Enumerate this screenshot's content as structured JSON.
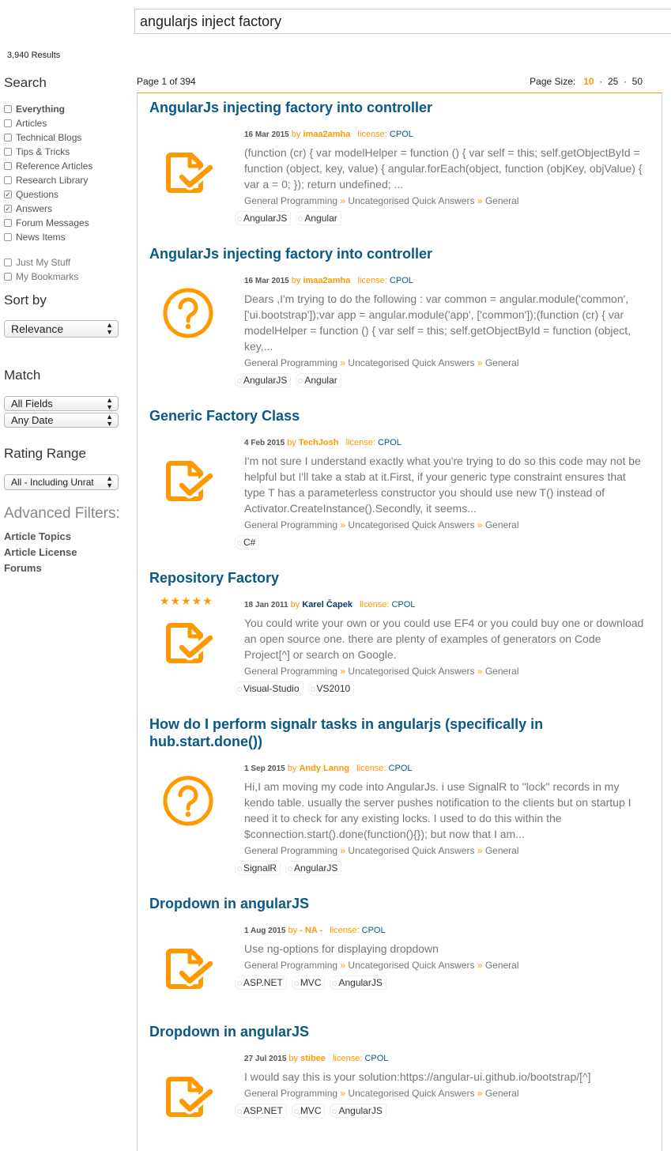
{
  "search": {
    "query": "angularjs inject factory"
  },
  "results_count": "3,940 Results",
  "sidebar": {
    "search_heading": "Search",
    "types": [
      {
        "label": "Everything",
        "checked": false
      },
      {
        "label": "Articles",
        "checked": false
      },
      {
        "label": "Technical Blogs",
        "checked": false
      },
      {
        "label": "Tips & Tricks",
        "checked": false
      },
      {
        "label": "Reference Articles",
        "checked": false
      },
      {
        "label": "Research Library",
        "checked": false
      },
      {
        "label": "Questions",
        "checked": true
      },
      {
        "label": "Answers",
        "checked": true
      },
      {
        "label": "Forum Messages",
        "checked": false
      },
      {
        "label": "News Items",
        "checked": false
      }
    ],
    "personal": [
      {
        "label": "Just My Stuff",
        "checked": false
      },
      {
        "label": "My Bookmarks",
        "checked": false
      }
    ],
    "sort_heading": "Sort by",
    "sort_value": "Relevance",
    "match_heading": "Match",
    "match_fields": "All Fields",
    "match_date": "Any Date",
    "rating_heading": "Rating Range",
    "rating_value": "All - Including Unrat",
    "advanced_heading": "Advanced Filters:",
    "advanced_links": [
      "Article Topics",
      "Article License",
      "Forums"
    ]
  },
  "pager": {
    "page_text": "Page 1 of 394",
    "size_label": "Page Size:",
    "sizes": [
      "10",
      "25",
      "50"
    ],
    "current_size": "10"
  },
  "results": [
    {
      "title": "AngularJs injecting factory into controller",
      "icon": "answer-document-check-icon",
      "date": "16 Mar 2015",
      "by": "by",
      "author": "imaa2amha",
      "license_label": "license:",
      "license": "CPOL",
      "desc": "(function (cr) { var modelHelper = function () { var self = this; self.getObjectById = function (object, key, value) { angular.forEach(object, function (objKey, objValue) { var a = 0; }); return undefined; ...",
      "cat": [
        "General Programming",
        "Uncategorised Quick Answers",
        "General"
      ],
      "tags": [
        "AngularJS",
        "Angular"
      ]
    },
    {
      "title": "AngularJs injecting factory into controller",
      "icon": "question-circle-icon",
      "date": "16 Mar 2015",
      "by": "by",
      "author": "imaa2amha",
      "license_label": "license:",
      "license": "CPOL",
      "desc": "Dears ,I'm trying to do the following : var common = angular.module('common', ['ui.bootstrap']);var app = angular.module('app', ['common']);(function (cr) { var modelHelper = function () { var self = this; self.getObjectById = function (object, key,...",
      "cat": [
        "General Programming",
        "Uncategorised Quick Answers",
        "General"
      ],
      "tags": [
        "AngularJS",
        "Angular"
      ]
    },
    {
      "title": "Generic Factory Class",
      "icon": "answer-document-check-icon",
      "date": "4 Feb 2015",
      "by": "by",
      "author": "TechJosh",
      "license_label": "license:",
      "license": "CPOL",
      "desc": "I'm not sure I understand exactly what you're trying to do so this code may not be helpful but I'll take a stab at it.First, if your generic type constraint ensures that type T has a parameterless constructor you should use new T() instead of Activator.CreateInstance().Secondly, it seems...",
      "cat": [
        "General Programming",
        "Uncategorised Quick Answers",
        "General"
      ],
      "tags": [
        "C#"
      ]
    },
    {
      "title": "Repository Factory",
      "icon": "answer-document-check-icon",
      "stars": "★★★★★",
      "date": "18 Jan 2011",
      "by": "by",
      "author": "Karel Čapek",
      "license_label": "license:",
      "license": "CPOL",
      "desc": "You could write your own or you could use EF4 or you could buy one or download an open source one. there are plenty of examples of generators on Code Project[^] or search on Google.",
      "cat": [
        "General Programming",
        "Uncategorised Quick Answers",
        "General"
      ],
      "tags": [
        "Visual-Studio",
        "VS2010"
      ]
    },
    {
      "title": "How do I perform signalr tasks in angularjs (specifically in hub.start.done())",
      "icon": "question-circle-icon",
      "date": "1 Sep 2015",
      "by": "by",
      "author": "Andy Lanng",
      "license_label": "license:",
      "license": "CPOL",
      "desc": "Hi,I am moving my code into AngularJs. i use SignalR to \"lock\" records in my kendo table. usually the server pushes notification to the clients but on startup I need it to check for any existing locks. I used to do this within the $connection.start().done(function(){}); but now that I am...",
      "cat": [
        "General Programming",
        "Uncategorised Quick Answers",
        "General"
      ],
      "tags": [
        "SignalR",
        "AngularJS"
      ]
    },
    {
      "title": "Dropdown in angularJS",
      "icon": "answer-document-check-icon",
      "date": "1 Aug 2015",
      "by": "by",
      "author": "- NA -",
      "license_label": "license:",
      "license": "CPOL",
      "desc": "Use ng-options for displaying dropdown",
      "cat": [
        "General Programming",
        "Uncategorised Quick Answers",
        "General"
      ],
      "tags": [
        "ASP.NET",
        "MVC",
        "AngularJS"
      ]
    },
    {
      "title": "Dropdown in angularJS",
      "icon": "answer-document-check-icon",
      "date": "27 Jul 2015",
      "by": "by",
      "author": "stibee",
      "license_label": "license:",
      "license": "CPOL",
      "desc": "I would say this is your solution:https://angular-ui.github.io/bootstrap/[^]",
      "cat": [
        "General Programming",
        "Uncategorised Quick Answers",
        "General"
      ],
      "tags": [
        "ASP.NET",
        "MVC",
        "AngularJS"
      ]
    }
  ],
  "cat_separator": "»",
  "colors": {
    "accent": "#ff9900",
    "link": "#0a5885",
    "border": "#c5d7e8"
  }
}
